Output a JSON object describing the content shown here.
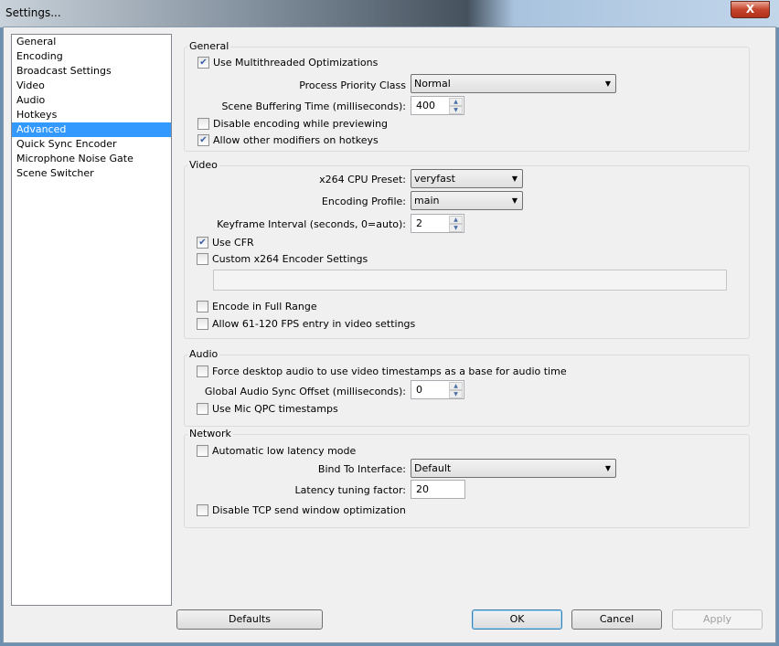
{
  "window": {
    "title": "Settings...",
    "close": "X"
  },
  "sidebar": {
    "items": [
      {
        "label": "General"
      },
      {
        "label": "Encoding"
      },
      {
        "label": "Broadcast Settings"
      },
      {
        "label": "Video"
      },
      {
        "label": "Audio"
      },
      {
        "label": "Hotkeys"
      },
      {
        "label": "Advanced",
        "selected": true
      },
      {
        "label": "Quick Sync Encoder"
      },
      {
        "label": "Microphone Noise Gate"
      },
      {
        "label": "Scene Switcher"
      }
    ]
  },
  "general": {
    "title": "General",
    "multithreaded": {
      "label": "Use Multithreaded Optimizations",
      "checked": true
    },
    "priority_label": "Process Priority Class",
    "priority_value": "Normal",
    "buffering_label": "Scene Buffering Time (milliseconds):",
    "buffering_value": "400",
    "disable_preview": {
      "label": "Disable encoding while previewing",
      "checked": false
    },
    "allow_modifiers": {
      "label": "Allow other modifiers on hotkeys",
      "checked": true
    }
  },
  "video": {
    "title": "Video",
    "preset_label": "x264 CPU Preset:",
    "preset_value": "veryfast",
    "profile_label": "Encoding Profile:",
    "profile_value": "main",
    "keyframe_label": "Keyframe Interval (seconds, 0=auto):",
    "keyframe_value": "2",
    "cfr": {
      "label": "Use CFR",
      "checked": true
    },
    "custom": {
      "label": "Custom x264 Encoder Settings",
      "checked": false
    },
    "custom_value": "",
    "full_range": {
      "label": "Encode in Full Range",
      "checked": false
    },
    "fps": {
      "label": "Allow 61-120 FPS entry in video settings",
      "checked": false
    }
  },
  "audio": {
    "title": "Audio",
    "force_ts": {
      "label": "Force desktop audio to use video timestamps as a base for audio time",
      "checked": false
    },
    "sync_label": "Global Audio Sync Offset (milliseconds):",
    "sync_value": "0",
    "qpc": {
      "label": "Use Mic QPC timestamps",
      "checked": false
    }
  },
  "network": {
    "title": "Network",
    "low_latency": {
      "label": "Automatic low latency mode",
      "checked": false
    },
    "bind_label": "Bind To Interface:",
    "bind_value": "Default",
    "latency_label": "Latency tuning factor:",
    "latency_value": "20",
    "disable_tcp": {
      "label": "Disable TCP send window optimization",
      "checked": false
    }
  },
  "buttons": {
    "defaults": "Defaults",
    "ok": "OK",
    "cancel": "Cancel",
    "apply": "Apply"
  }
}
